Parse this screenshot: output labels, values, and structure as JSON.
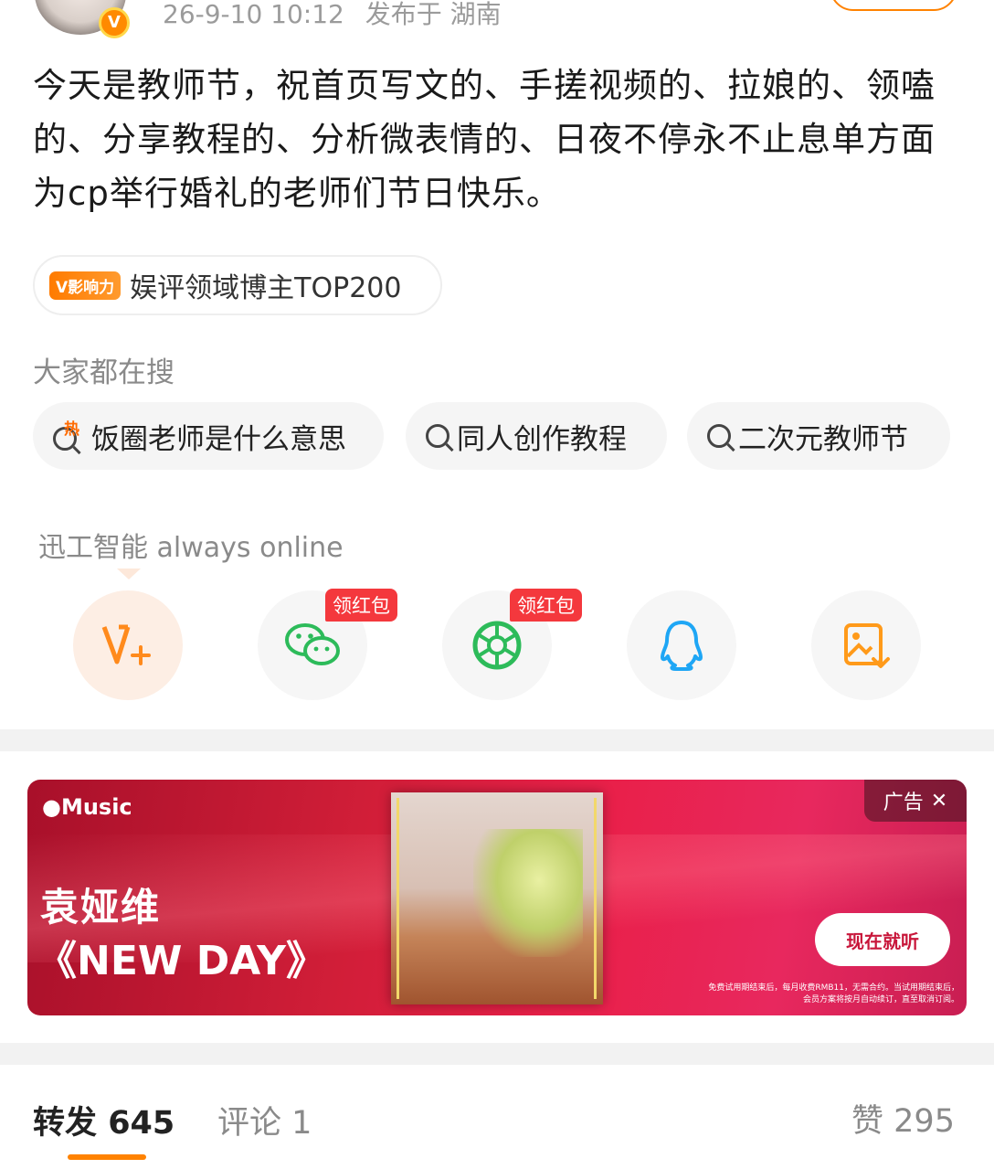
{
  "post": {
    "timestamp": "26-9-10 10:12",
    "location": "发布于 湖南",
    "text": "今天是教师节，祝首页写文的、手搓视频的、拉娘的、领嗑的、分享教程的、分析微表情的、日夜不停永不止息单方面为cp举行婚礼的老师们节日快乐。",
    "influence": {
      "tag": "V影响力",
      "label": "娱评领域博主TOP200"
    }
  },
  "search": {
    "title": "大家都在搜",
    "hot_mark": "热",
    "items": [
      {
        "label": "饭圈老师是什么意思"
      },
      {
        "label": "同人创作教程"
      },
      {
        "label": "二次元教师节"
      }
    ]
  },
  "ai_bar": {
    "label": "迅工智能 always online"
  },
  "share": {
    "redpack_label": "领红包",
    "items": [
      "vplus-icon",
      "wechat-icon",
      "moments-icon",
      "qq-icon",
      "save-image-icon"
    ]
  },
  "ad": {
    "brand": "Music",
    "artist": "袁娅维",
    "album": "《NEW DAY》",
    "ad_label": "广告",
    "close": "✕",
    "cta": "现在就听",
    "fineprint": "免费试用期结束后，每月收费RMB11，无需合约。当试用期结束后，会员方案将按月自动续订，直至取消订阅。"
  },
  "tabs": {
    "repost_label": "转发",
    "repost_count": "645",
    "comment_label": "评论",
    "comment_count": "1",
    "like_label": "赞",
    "like_count": "295"
  },
  "colors": {
    "accent": "#ff8200",
    "redpack": "#f4383d",
    "wechat": "#2dbb5a",
    "qq": "#1ea6f5"
  }
}
